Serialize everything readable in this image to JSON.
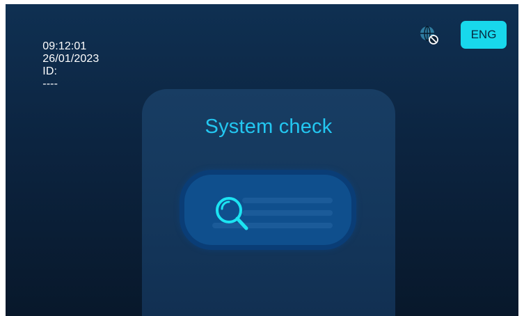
{
  "status_bar": {
    "time": "09:12:01",
    "date": "26/01/2023",
    "id_label": "ID:",
    "id_value": "----",
    "network_icon": "globe-disconnected-icon",
    "language_button": "ENG"
  },
  "panel": {
    "title": "System check",
    "icon": "magnifier-icon"
  },
  "colors": {
    "screen_top": "#0f3052",
    "screen_bottom": "#08182b",
    "accent": "#18d8ec",
    "title": "#23c7f1"
  }
}
